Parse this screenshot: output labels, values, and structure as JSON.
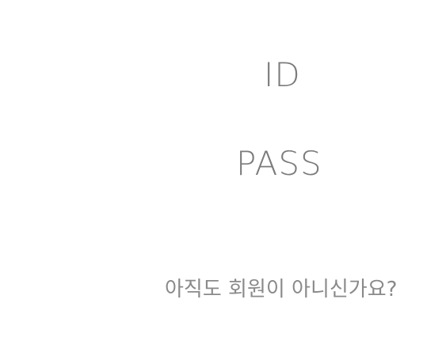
{
  "login": {
    "id_label": "ID",
    "pass_label": "PASS",
    "signup_prompt": "아직도 회원이 아니신가요?"
  }
}
